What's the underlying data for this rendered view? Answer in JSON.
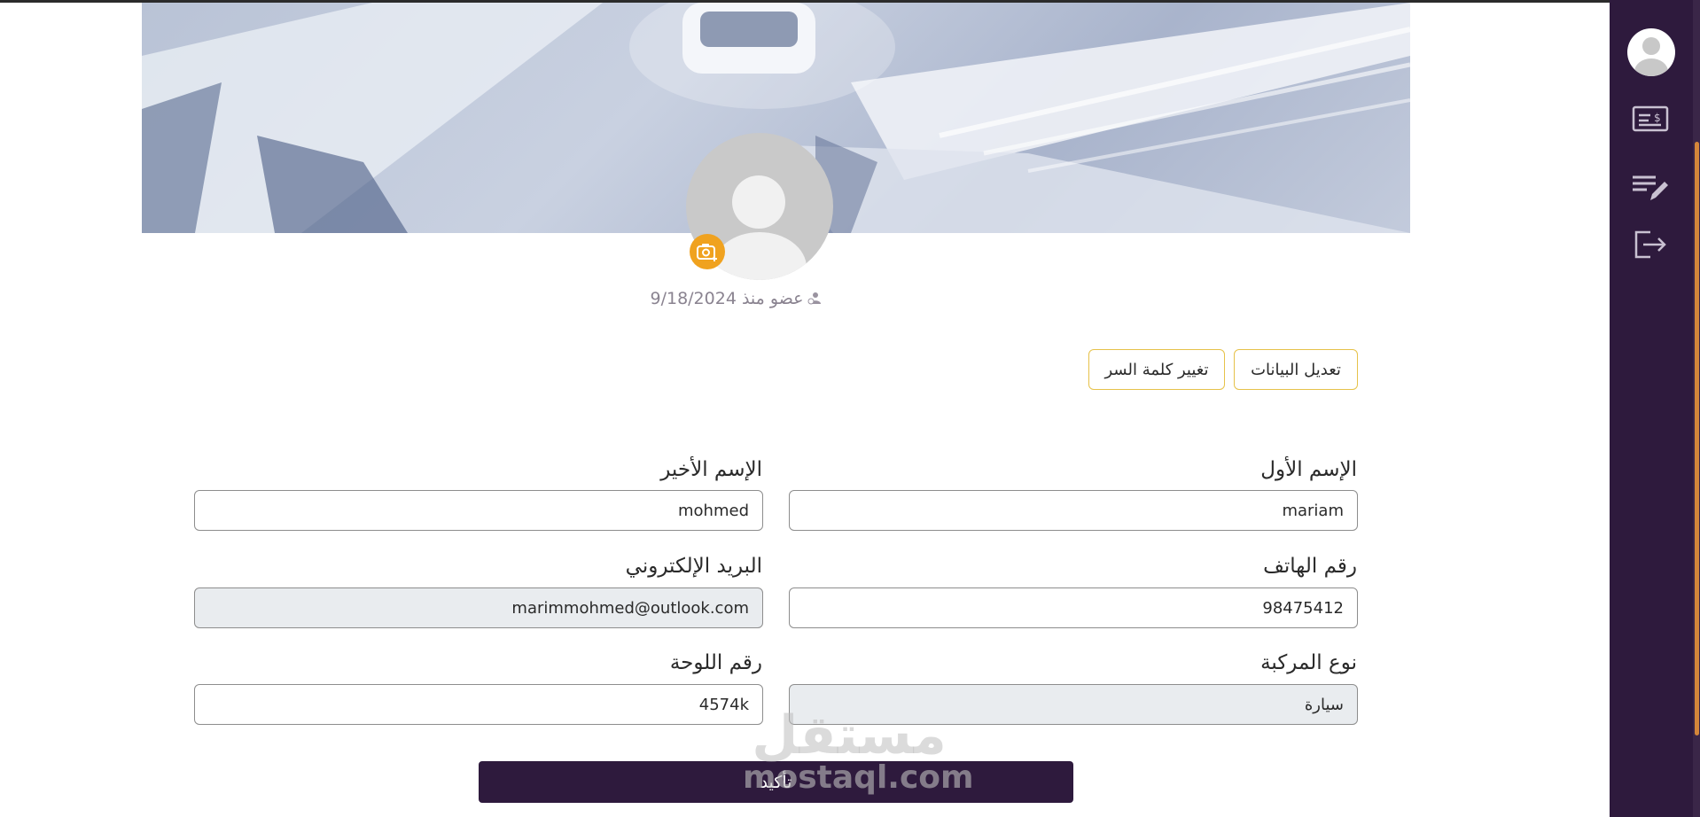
{
  "profile": {
    "member_since_label": "عضو منذ",
    "member_since_date": "9/18/2024"
  },
  "tabs": {
    "edit_data": "تعديل البيانات",
    "change_password": "تغيير كلمة السر"
  },
  "form": {
    "first_name_label": "الإسم الأول",
    "first_name_value": "mariam",
    "last_name_label": "الإسم الأخير",
    "last_name_value": "mohmed",
    "phone_label": "رقم الهاتف",
    "phone_value": "98475412",
    "email_label": "البريد الإلكتروني",
    "email_value": "marimmohmed@outlook.com",
    "vehicle_type_label": "نوع المركبة",
    "vehicle_type_value": "سيارة",
    "plate_label": "رقم اللوحة",
    "plate_value": "4574k",
    "confirm_label": "تأكيد"
  },
  "watermark": {
    "arabic": "مستقل",
    "latin": "mostaql.com"
  },
  "sidebar": {
    "icons": [
      "user-avatar-icon",
      "payment-icon",
      "edit-list-icon",
      "logout-icon"
    ]
  },
  "colors": {
    "sidebar_bg": "#2e1a3d",
    "accent_orange": "#f0a21f",
    "tab_border": "#e6c24a",
    "confirm_bg": "#2e1a3d"
  }
}
